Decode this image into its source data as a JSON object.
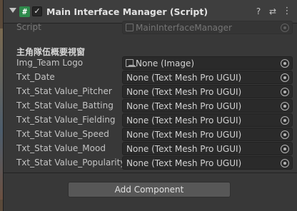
{
  "component": {
    "title": "Main Interface Manager (Script)",
    "script_icon_glyph": "#",
    "enabled_glyph": "✓"
  },
  "icons": {
    "help": "?",
    "presets": "⇄",
    "menu": "⋮"
  },
  "script_field": {
    "label": "Script",
    "value": "MainInterfaceManager"
  },
  "section_header": "主角隊伍概要視窗",
  "fields": [
    {
      "label": "Img_Team Logo",
      "value": "None (Image)"
    },
    {
      "label": "Txt_Date",
      "value": "None (Text Mesh Pro UGUI)"
    },
    {
      "label": "Txt_Stat Value_Pitcher",
      "value": "None (Text Mesh Pro UGUI)"
    },
    {
      "label": "Txt_Stat Value_Batting",
      "value": "None (Text Mesh Pro UGUI)"
    },
    {
      "label": "Txt_Stat Value_Fielding",
      "value": "None (Text Mesh Pro UGUI)"
    },
    {
      "label": "Txt_Stat Value_Speed",
      "value": "None (Text Mesh Pro UGUI)"
    },
    {
      "label": "Txt_Stat Value_Mood",
      "value": "None (Text Mesh Pro UGUI)"
    },
    {
      "label": "Txt_Stat Value_Popularity",
      "value": "None (Text Mesh Pro UGUI)"
    }
  ],
  "add_component_label": "Add Component"
}
